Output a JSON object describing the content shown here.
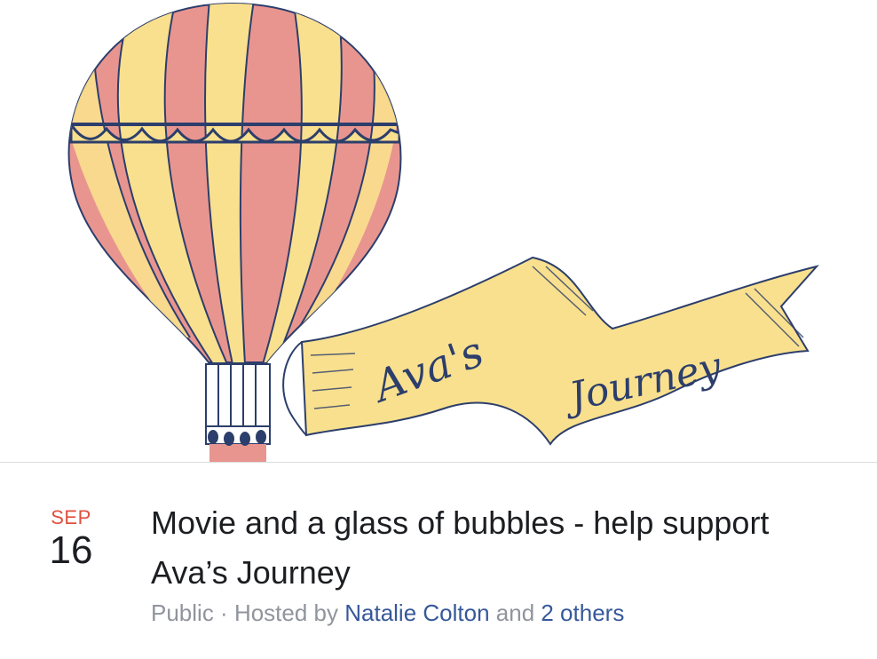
{
  "cover": {
    "banner_text_1": "Ava's",
    "banner_text_2": "Journey",
    "colors": {
      "pink": "#e89590",
      "yellow": "#f9e08e",
      "navy": "#2c3e6b"
    }
  },
  "event": {
    "month": "SEP",
    "day": "16",
    "title": "Movie and a glass of bubbles - help support Ava’s Journey",
    "privacy": "Public",
    "separator": " · ",
    "hosted_by_label": "Hosted by ",
    "host_name": "Natalie Colton",
    "and_label": " and ",
    "others_link": "2 others"
  }
}
